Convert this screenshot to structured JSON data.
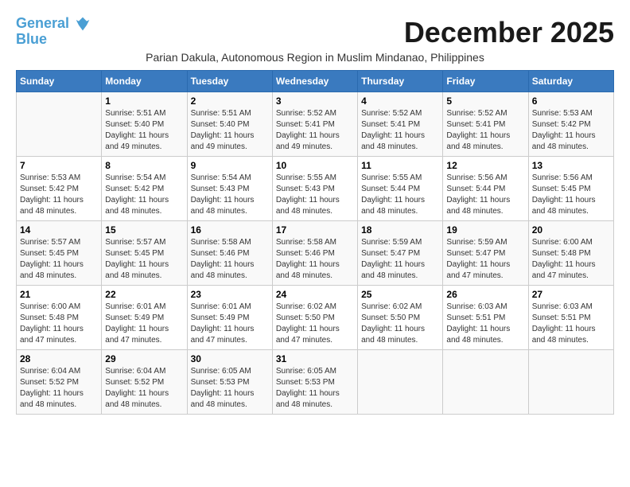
{
  "logo": {
    "line1": "General",
    "line2": "Blue"
  },
  "title": "December 2025",
  "subtitle": "Parian Dakula, Autonomous Region in Muslim Mindanao, Philippines",
  "header": {
    "days": [
      "Sunday",
      "Monday",
      "Tuesday",
      "Wednesday",
      "Thursday",
      "Friday",
      "Saturday"
    ]
  },
  "weeks": [
    {
      "cells": [
        {
          "empty": true
        },
        {
          "day": "1",
          "sunrise": "5:51 AM",
          "sunset": "5:40 PM",
          "daylight": "11 hours and 49 minutes."
        },
        {
          "day": "2",
          "sunrise": "5:51 AM",
          "sunset": "5:40 PM",
          "daylight": "11 hours and 49 minutes."
        },
        {
          "day": "3",
          "sunrise": "5:52 AM",
          "sunset": "5:41 PM",
          "daylight": "11 hours and 49 minutes."
        },
        {
          "day": "4",
          "sunrise": "5:52 AM",
          "sunset": "5:41 PM",
          "daylight": "11 hours and 48 minutes."
        },
        {
          "day": "5",
          "sunrise": "5:52 AM",
          "sunset": "5:41 PM",
          "daylight": "11 hours and 48 minutes."
        },
        {
          "day": "6",
          "sunrise": "5:53 AM",
          "sunset": "5:42 PM",
          "daylight": "11 hours and 48 minutes."
        }
      ]
    },
    {
      "cells": [
        {
          "day": "7",
          "sunrise": "5:53 AM",
          "sunset": "5:42 PM",
          "daylight": "11 hours and 48 minutes."
        },
        {
          "day": "8",
          "sunrise": "5:54 AM",
          "sunset": "5:42 PM",
          "daylight": "11 hours and 48 minutes."
        },
        {
          "day": "9",
          "sunrise": "5:54 AM",
          "sunset": "5:43 PM",
          "daylight": "11 hours and 48 minutes."
        },
        {
          "day": "10",
          "sunrise": "5:55 AM",
          "sunset": "5:43 PM",
          "daylight": "11 hours and 48 minutes."
        },
        {
          "day": "11",
          "sunrise": "5:55 AM",
          "sunset": "5:44 PM",
          "daylight": "11 hours and 48 minutes."
        },
        {
          "day": "12",
          "sunrise": "5:56 AM",
          "sunset": "5:44 PM",
          "daylight": "11 hours and 48 minutes."
        },
        {
          "day": "13",
          "sunrise": "5:56 AM",
          "sunset": "5:45 PM",
          "daylight": "11 hours and 48 minutes."
        }
      ]
    },
    {
      "cells": [
        {
          "day": "14",
          "sunrise": "5:57 AM",
          "sunset": "5:45 PM",
          "daylight": "11 hours and 48 minutes."
        },
        {
          "day": "15",
          "sunrise": "5:57 AM",
          "sunset": "5:45 PM",
          "daylight": "11 hours and 48 minutes."
        },
        {
          "day": "16",
          "sunrise": "5:58 AM",
          "sunset": "5:46 PM",
          "daylight": "11 hours and 48 minutes."
        },
        {
          "day": "17",
          "sunrise": "5:58 AM",
          "sunset": "5:46 PM",
          "daylight": "11 hours and 48 minutes."
        },
        {
          "day": "18",
          "sunrise": "5:59 AM",
          "sunset": "5:47 PM",
          "daylight": "11 hours and 48 minutes."
        },
        {
          "day": "19",
          "sunrise": "5:59 AM",
          "sunset": "5:47 PM",
          "daylight": "11 hours and 47 minutes."
        },
        {
          "day": "20",
          "sunrise": "6:00 AM",
          "sunset": "5:48 PM",
          "daylight": "11 hours and 47 minutes."
        }
      ]
    },
    {
      "cells": [
        {
          "day": "21",
          "sunrise": "6:00 AM",
          "sunset": "5:48 PM",
          "daylight": "11 hours and 47 minutes."
        },
        {
          "day": "22",
          "sunrise": "6:01 AM",
          "sunset": "5:49 PM",
          "daylight": "11 hours and 47 minutes."
        },
        {
          "day": "23",
          "sunrise": "6:01 AM",
          "sunset": "5:49 PM",
          "daylight": "11 hours and 47 minutes."
        },
        {
          "day": "24",
          "sunrise": "6:02 AM",
          "sunset": "5:50 PM",
          "daylight": "11 hours and 47 minutes."
        },
        {
          "day": "25",
          "sunrise": "6:02 AM",
          "sunset": "5:50 PM",
          "daylight": "11 hours and 48 minutes."
        },
        {
          "day": "26",
          "sunrise": "6:03 AM",
          "sunset": "5:51 PM",
          "daylight": "11 hours and 48 minutes."
        },
        {
          "day": "27",
          "sunrise": "6:03 AM",
          "sunset": "5:51 PM",
          "daylight": "11 hours and 48 minutes."
        }
      ]
    },
    {
      "cells": [
        {
          "day": "28",
          "sunrise": "6:04 AM",
          "sunset": "5:52 PM",
          "daylight": "11 hours and 48 minutes."
        },
        {
          "day": "29",
          "sunrise": "6:04 AM",
          "sunset": "5:52 PM",
          "daylight": "11 hours and 48 minutes."
        },
        {
          "day": "30",
          "sunrise": "6:05 AM",
          "sunset": "5:53 PM",
          "daylight": "11 hours and 48 minutes."
        },
        {
          "day": "31",
          "sunrise": "6:05 AM",
          "sunset": "5:53 PM",
          "daylight": "11 hours and 48 minutes."
        },
        {
          "empty": true
        },
        {
          "empty": true
        },
        {
          "empty": true
        }
      ]
    }
  ],
  "labels": {
    "sunrise": "Sunrise:",
    "sunset": "Sunset:",
    "daylight": "Daylight:"
  }
}
